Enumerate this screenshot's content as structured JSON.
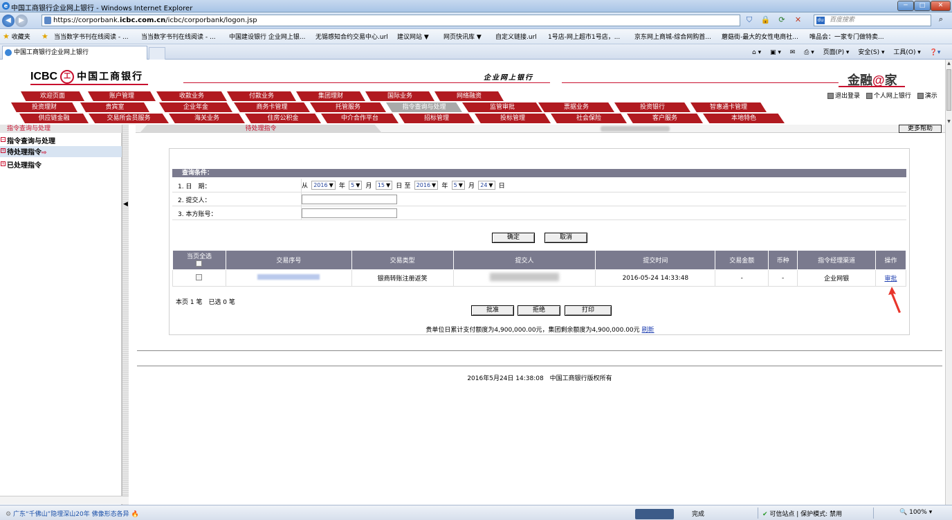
{
  "browser": {
    "window_title": "中国工商银行企业网上银行 - Windows Internet Explorer",
    "url_prefix": "https://corporbank.",
    "url_host": "icbc.com.cn",
    "url_path": "/icbc/corporbank/logon.jsp",
    "search_placeholder": "百度搜索",
    "search_engine_icon": "du",
    "favorites_label": "收藏夹",
    "favorites": [
      "当当数字书刊在线阅读 - ...",
      "当当数字书刊在线阅读 - ...",
      "中国建设银行 企业网上银...",
      "无锡感知合约交易中心.url",
      "建议网站 ▼",
      "网页快讯库 ▼",
      "自定义链接.url",
      "1号店-网上超市1号店，...",
      "京东网上商城-综合网购首...",
      "蘑菇街-最大的女性电商社...",
      "唯品会：一家专门做特卖..."
    ],
    "tab_title": "中国工商银行企业网上银行",
    "commands": [
      "页面(P) ▾",
      "安全(S) ▾",
      "工具(O) ▾"
    ],
    "status_news": "广东“千佛山”隐埋深山20年 佛像形态各异",
    "status_done": "完成",
    "status_protect": "可信站点 | 保护模式: 禁用",
    "status_zoom": "100%"
  },
  "header": {
    "logo_en": "ICBC",
    "logo_emblem": "工",
    "logo_cn": "中国工商银行",
    "corp_title": "企业网上银行",
    "brand_pre": "金融",
    "brand_at": "@",
    "brand_post": "家",
    "links": [
      "退出登录",
      "个人网上银行",
      "演示"
    ]
  },
  "menu": {
    "row1": [
      "欢迎页面",
      "账户管理",
      "收款业务",
      "付款业务",
      "集团理财",
      "国际业务",
      "网络融资"
    ],
    "row2": [
      "投资理财",
      "贵宾室",
      "企业年金",
      "商务卡管理",
      "托管服务",
      "指令查询与处理",
      "监管审批",
      "票据业务",
      "投资银行",
      "智惠通卡管理"
    ],
    "row3": [
      "供应链金融",
      "交易所会员服务",
      "海关业务",
      "住房公积金",
      "中介合作平台",
      "招标管理",
      "投标管理",
      "社会保险",
      "客户服务",
      "本地特色"
    ],
    "active": "指令查询与处理"
  },
  "subbar": {
    "tab": "待处理指令",
    "help": "更多帮助"
  },
  "tree": {
    "header": "指令查询与处理",
    "root": "指令查询与处理",
    "pending": "待处理指令",
    "done": "已处理指令",
    "pending_arrow": "⇨"
  },
  "query": {
    "title": "查询条件：",
    "row1_label": "1. 日　期：",
    "row2_label": "2. 提交人：",
    "row3_label": "3. 本方账号：",
    "from": "从",
    "to": "至",
    "year": "年",
    "month": "月",
    "day": "日",
    "start_year": "2016",
    "start_month": "5",
    "start_day": "15",
    "end_year": "2016",
    "end_month": "5",
    "end_day": "24",
    "submitter_value": "",
    "account_value": "",
    "confirm": "确定",
    "cancel": "取消"
  },
  "table": {
    "headers": [
      "当页全选",
      "交易序号",
      "交易类型",
      "提交人",
      "提交时间",
      "交易金额",
      "币种",
      "指令经理渠道",
      "操作"
    ],
    "rows": [
      {
        "type": "银商转账注册返笑",
        "time": "2016-05-24 14:33:48",
        "amount": "-",
        "currency": "-",
        "channel": "企业网银",
        "action": "审批"
      }
    ],
    "summary": "本页 1 笔　已选 0 笔",
    "approve": "批准",
    "reject": "拒绝",
    "print": "打印",
    "quota_text": "贵单位日累计支付额度为4,900,000.00元，集团剩余额度为4,900,000.00元",
    "refresh": "刷新"
  },
  "footer": {
    "text": "2016年5月24日 14:38:08　中国工商银行版权所有"
  },
  "colors": {
    "menu_red": "#b11a20",
    "brand_red": "#c8102e",
    "table_header": "#7a7a8e",
    "annotation_arrow": "#e8362c"
  }
}
